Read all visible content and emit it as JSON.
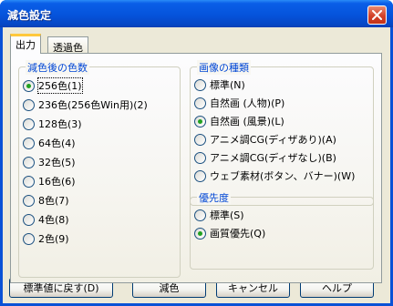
{
  "window": {
    "title": "減色設定"
  },
  "tabs": [
    {
      "label": "出力"
    },
    {
      "label": "透過色"
    }
  ],
  "color_count_group": {
    "title": "減色後の色数",
    "options": [
      {
        "label": "256色(1)",
        "checked": true
      },
      {
        "label": "236色(256色Win用)(2)",
        "checked": false
      },
      {
        "label": "128色(3)",
        "checked": false
      },
      {
        "label": "64色(4)",
        "checked": false
      },
      {
        "label": "32色(5)",
        "checked": false
      },
      {
        "label": "16色(6)",
        "checked": false
      },
      {
        "label": "8色(7)",
        "checked": false
      },
      {
        "label": "4色(8)",
        "checked": false
      },
      {
        "label": "2色(9)",
        "checked": false
      }
    ]
  },
  "image_type_group": {
    "title": "画像の種類",
    "options": [
      {
        "label": "標準(N)",
        "checked": false
      },
      {
        "label": "自然画 (人物)(P)",
        "checked": false
      },
      {
        "label": "自然画 (風景)(L)",
        "checked": true
      },
      {
        "label": "アニメ調CG(ディザあり)(A)",
        "checked": false
      },
      {
        "label": "アニメ調CG(ディザなし)(B)",
        "checked": false
      },
      {
        "label": "ウェブ素材(ボタン、バナー)(W)",
        "checked": false
      }
    ]
  },
  "priority_group": {
    "title": "優先度",
    "options": [
      {
        "label": "標準(S)",
        "checked": false
      },
      {
        "label": "画質優先(Q)",
        "checked": true
      }
    ]
  },
  "buttons": {
    "reset": "標準値に戻す(D)",
    "apply": "減色",
    "cancel": "キャンセル",
    "help": "ヘルプ"
  },
  "colors": {
    "title_bar": "#0553db",
    "group_title": "#0046d5",
    "dialog_face": "#ece9d8",
    "radio_dot": "#21a121"
  }
}
